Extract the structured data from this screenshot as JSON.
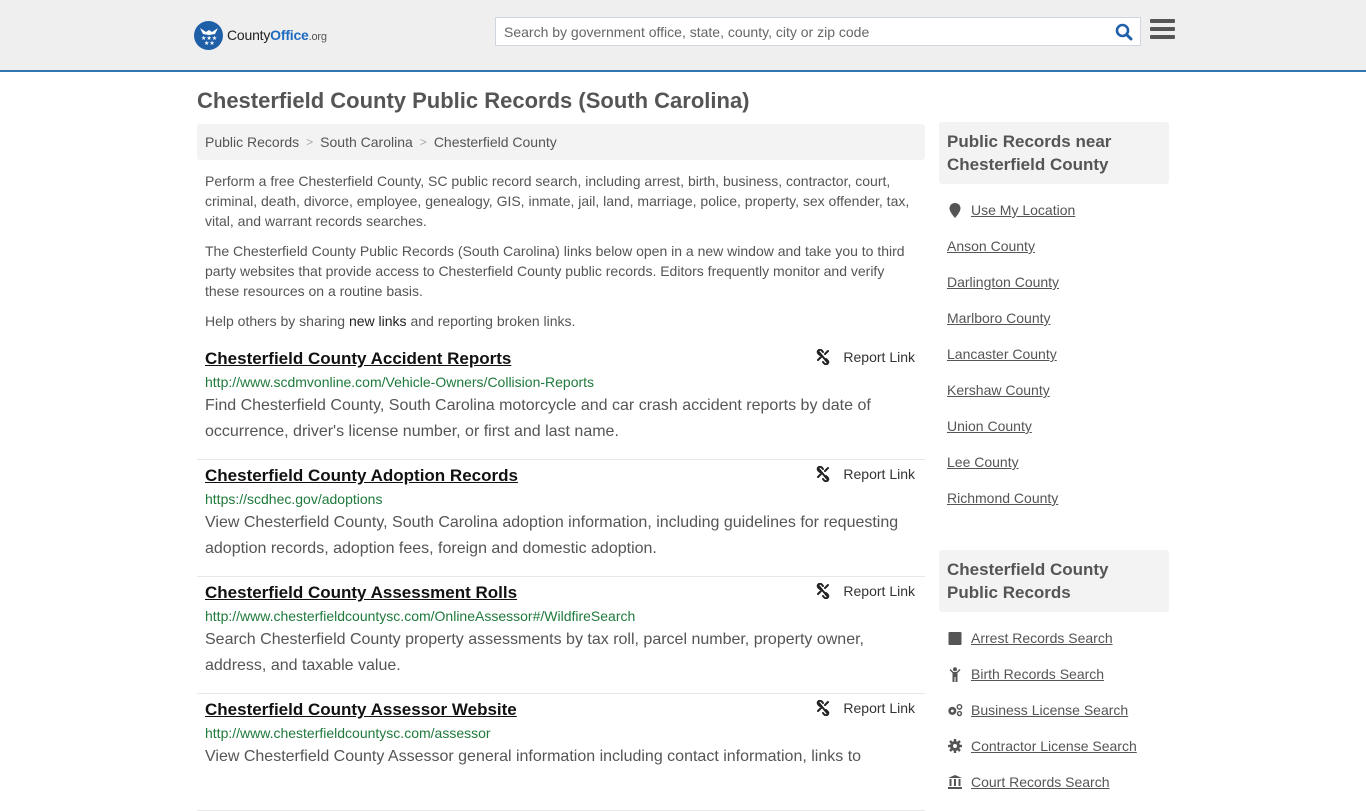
{
  "header": {
    "logo": {
      "part1": "County",
      "part2": "Office",
      "part3": ".org"
    },
    "search": {
      "placeholder": "Search by government office, state, county, city or zip code",
      "value": ""
    },
    "colors": {
      "brand": "#1e5fa8",
      "accent_border": "#2f76b3"
    }
  },
  "page": {
    "title": "Chesterfield County Public Records (South Carolina)"
  },
  "breadcrumb": [
    {
      "label": "Public Records"
    },
    {
      "label": "South Carolina"
    },
    {
      "label": "Chesterfield County"
    }
  ],
  "intro": {
    "paragraph1": "Perform a free Chesterfield County, SC public record search, including arrest, birth, business, contractor, court, criminal, death, divorce, employee, genealogy, GIS, inmate, jail, land, marriage, police, property, sex offender, tax, vital, and warrant records searches.",
    "paragraph2": "The Chesterfield County Public Records (South Carolina) links below open in a new window and take you to third party websites that provide access to Chesterfield County public records. Editors frequently monitor and verify these resources on a routine basis.",
    "help_prefix": "Help others by sharing ",
    "help_link": "new links",
    "help_suffix": " and reporting broken links."
  },
  "records": [
    {
      "title": "Chesterfield County Accident Reports",
      "url": "http://www.scdmvonline.com/Vehicle-Owners/Collision-Reports",
      "description": "Find Chesterfield County, South Carolina motorcycle and car crash accident reports by date of occurrence, driver's license number, or first and last name.",
      "report_label": "Report Link"
    },
    {
      "title": "Chesterfield County Adoption Records",
      "url": "https://scdhec.gov/adoptions",
      "description": "View Chesterfield County, South Carolina adoption information, including guidelines for requesting adoption records, adoption fees, foreign and domestic adoption.",
      "report_label": "Report Link"
    },
    {
      "title": "Chesterfield County Assessment Rolls",
      "url": "http://www.chesterfieldcountysc.com/OnlineAssessor#/WildfireSearch",
      "description": "Search Chesterfield County property assessments by tax roll, parcel number, property owner, address, and taxable value.",
      "report_label": "Report Link"
    },
    {
      "title": "Chesterfield County Assessor Website",
      "url": "http://www.chesterfieldcountysc.com/assessor",
      "description": "View Chesterfield County Assessor general information including contact information, links to",
      "report_label": "Report Link"
    }
  ],
  "sidebar": {
    "near": {
      "heading": "Public Records near Chesterfield County",
      "use_location": "Use My Location",
      "counties": [
        "Anson County",
        "Darlington County",
        "Marlboro County",
        "Lancaster County",
        "Kershaw County",
        "Union County",
        "Lee County",
        "Richmond County"
      ]
    },
    "public_records": {
      "heading": "Chesterfield County Public Records",
      "items": [
        {
          "label": "Arrest Records Search",
          "icon": "arrest-icon"
        },
        {
          "label": "Birth Records Search",
          "icon": "baby-icon"
        },
        {
          "label": "Business License Search",
          "icon": "gears-icon"
        },
        {
          "label": "Contractor License Search",
          "icon": "gear-icon"
        },
        {
          "label": "Court Records Search",
          "icon": "courthouse-icon"
        }
      ]
    }
  }
}
